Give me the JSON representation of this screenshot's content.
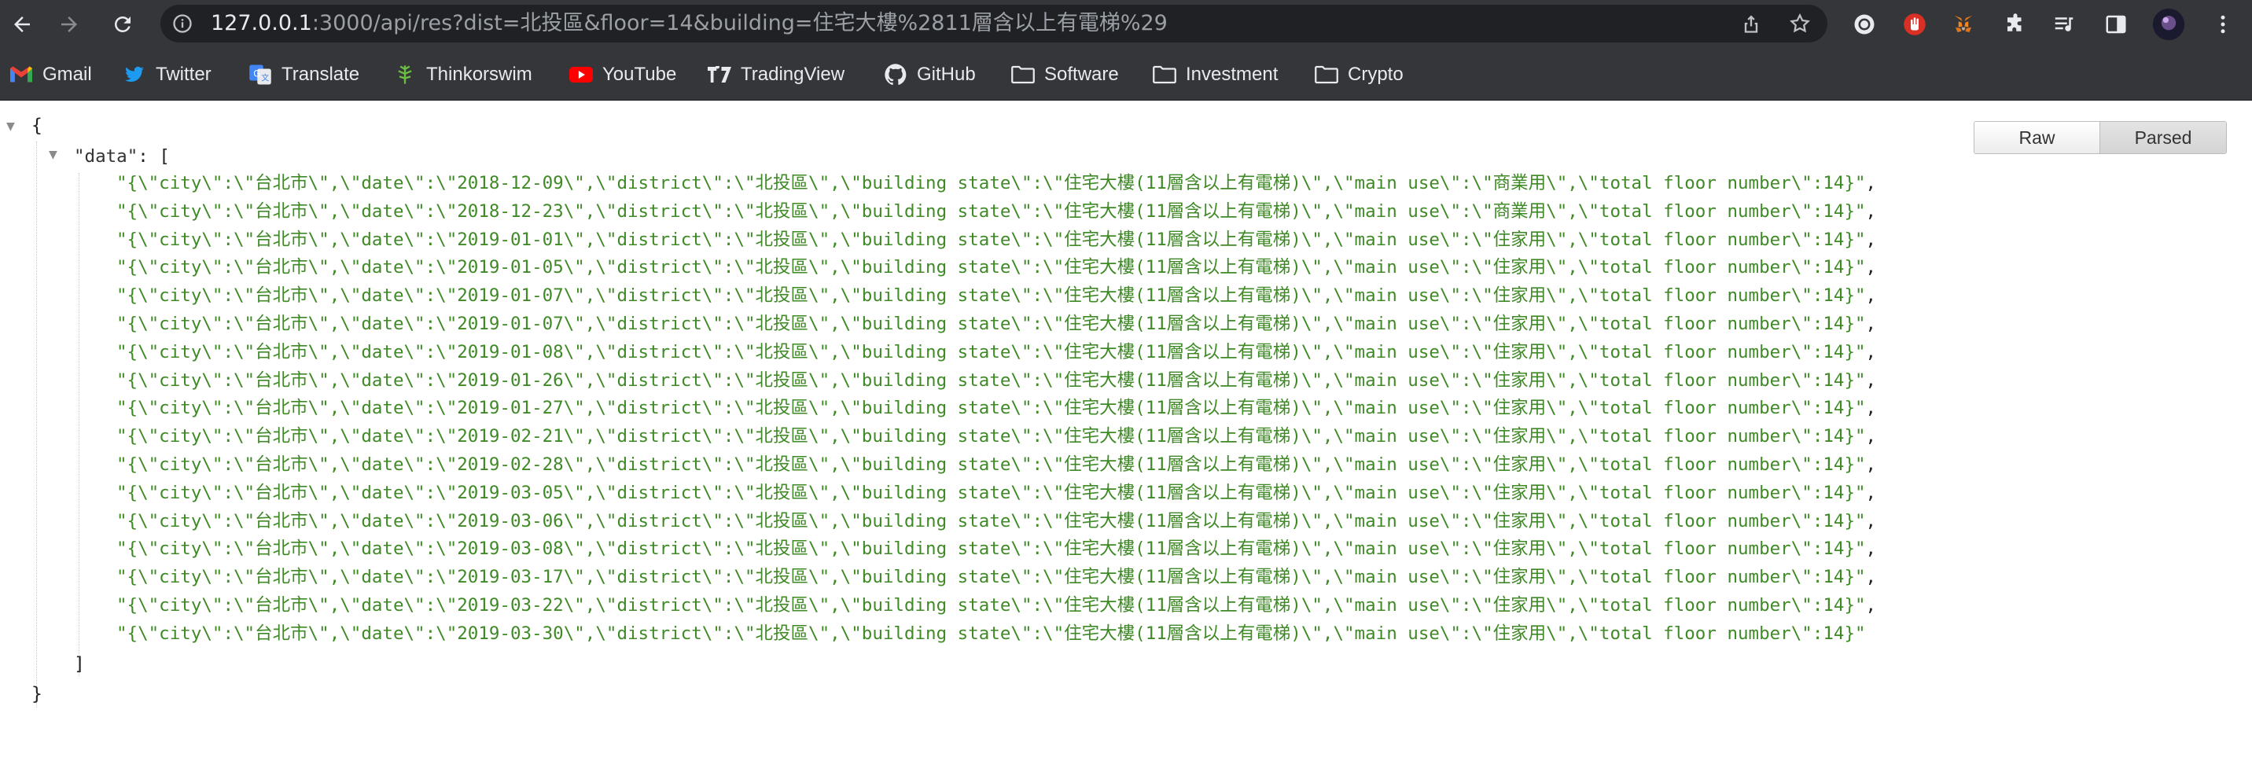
{
  "browser": {
    "url_host": "127.0.0.1",
    "url_rest": ":3000/api/res?dist=北投區&floor=14&building=住宅大樓%2811層含以上有電梯%29"
  },
  "bookmarks": [
    {
      "label": "Gmail",
      "icon": "gmail-icon"
    },
    {
      "label": "Twitter",
      "icon": "twitter-icon"
    },
    {
      "label": "Translate",
      "icon": "translate-icon"
    },
    {
      "label": "Thinkorswim",
      "icon": "thinkorswim-icon"
    },
    {
      "label": "YouTube",
      "icon": "youtube-icon"
    },
    {
      "label": "TradingView",
      "icon": "tradingview-icon"
    },
    {
      "label": "GitHub",
      "icon": "github-icon"
    },
    {
      "label": "Software",
      "icon": "folder-icon"
    },
    {
      "label": "Investment",
      "icon": "folder-icon"
    },
    {
      "label": "Crypto",
      "icon": "folder-icon"
    }
  ],
  "viewer": {
    "raw_label": "Raw",
    "parsed_label": "Parsed",
    "open_brace": "{",
    "close_brace": "}",
    "key_label": "\"data\"",
    "key_colon": ": [",
    "close_bracket": "]"
  },
  "rows": [
    "\"{\\\"city\\\":\\\"台北市\\\",\\\"date\\\":\\\"2018-12-09\\\",\\\"district\\\":\\\"北投區\\\",\\\"building state\\\":\\\"住宅大樓(11層含以上有電梯)\\\",\\\"main use\\\":\\\"商業用\\\",\\\"total floor number\\\":14}\"",
    "\"{\\\"city\\\":\\\"台北市\\\",\\\"date\\\":\\\"2018-12-23\\\",\\\"district\\\":\\\"北投區\\\",\\\"building state\\\":\\\"住宅大樓(11層含以上有電梯)\\\",\\\"main use\\\":\\\"商業用\\\",\\\"total floor number\\\":14}\"",
    "\"{\\\"city\\\":\\\"台北市\\\",\\\"date\\\":\\\"2019-01-01\\\",\\\"district\\\":\\\"北投區\\\",\\\"building state\\\":\\\"住宅大樓(11層含以上有電梯)\\\",\\\"main use\\\":\\\"住家用\\\",\\\"total floor number\\\":14}\"",
    "\"{\\\"city\\\":\\\"台北市\\\",\\\"date\\\":\\\"2019-01-05\\\",\\\"district\\\":\\\"北投區\\\",\\\"building state\\\":\\\"住宅大樓(11層含以上有電梯)\\\",\\\"main use\\\":\\\"住家用\\\",\\\"total floor number\\\":14}\"",
    "\"{\\\"city\\\":\\\"台北市\\\",\\\"date\\\":\\\"2019-01-07\\\",\\\"district\\\":\\\"北投區\\\",\\\"building state\\\":\\\"住宅大樓(11層含以上有電梯)\\\",\\\"main use\\\":\\\"住家用\\\",\\\"total floor number\\\":14}\"",
    "\"{\\\"city\\\":\\\"台北市\\\",\\\"date\\\":\\\"2019-01-07\\\",\\\"district\\\":\\\"北投區\\\",\\\"building state\\\":\\\"住宅大樓(11層含以上有電梯)\\\",\\\"main use\\\":\\\"住家用\\\",\\\"total floor number\\\":14}\"",
    "\"{\\\"city\\\":\\\"台北市\\\",\\\"date\\\":\\\"2019-01-08\\\",\\\"district\\\":\\\"北投區\\\",\\\"building state\\\":\\\"住宅大樓(11層含以上有電梯)\\\",\\\"main use\\\":\\\"住家用\\\",\\\"total floor number\\\":14}\"",
    "\"{\\\"city\\\":\\\"台北市\\\",\\\"date\\\":\\\"2019-01-26\\\",\\\"district\\\":\\\"北投區\\\",\\\"building state\\\":\\\"住宅大樓(11層含以上有電梯)\\\",\\\"main use\\\":\\\"住家用\\\",\\\"total floor number\\\":14}\"",
    "\"{\\\"city\\\":\\\"台北市\\\",\\\"date\\\":\\\"2019-01-27\\\",\\\"district\\\":\\\"北投區\\\",\\\"building state\\\":\\\"住宅大樓(11層含以上有電梯)\\\",\\\"main use\\\":\\\"住家用\\\",\\\"total floor number\\\":14}\"",
    "\"{\\\"city\\\":\\\"台北市\\\",\\\"date\\\":\\\"2019-02-21\\\",\\\"district\\\":\\\"北投區\\\",\\\"building state\\\":\\\"住宅大樓(11層含以上有電梯)\\\",\\\"main use\\\":\\\"住家用\\\",\\\"total floor number\\\":14}\"",
    "\"{\\\"city\\\":\\\"台北市\\\",\\\"date\\\":\\\"2019-02-28\\\",\\\"district\\\":\\\"北投區\\\",\\\"building state\\\":\\\"住宅大樓(11層含以上有電梯)\\\",\\\"main use\\\":\\\"住家用\\\",\\\"total floor number\\\":14}\"",
    "\"{\\\"city\\\":\\\"台北市\\\",\\\"date\\\":\\\"2019-03-05\\\",\\\"district\\\":\\\"北投區\\\",\\\"building state\\\":\\\"住宅大樓(11層含以上有電梯)\\\",\\\"main use\\\":\\\"住家用\\\",\\\"total floor number\\\":14}\"",
    "\"{\\\"city\\\":\\\"台北市\\\",\\\"date\\\":\\\"2019-03-06\\\",\\\"district\\\":\\\"北投區\\\",\\\"building state\\\":\\\"住宅大樓(11層含以上有電梯)\\\",\\\"main use\\\":\\\"住家用\\\",\\\"total floor number\\\":14}\"",
    "\"{\\\"city\\\":\\\"台北市\\\",\\\"date\\\":\\\"2019-03-08\\\",\\\"district\\\":\\\"北投區\\\",\\\"building state\\\":\\\"住宅大樓(11層含以上有電梯)\\\",\\\"main use\\\":\\\"住家用\\\",\\\"total floor number\\\":14}\"",
    "\"{\\\"city\\\":\\\"台北市\\\",\\\"date\\\":\\\"2019-03-17\\\",\\\"district\\\":\\\"北投區\\\",\\\"building state\\\":\\\"住宅大樓(11層含以上有電梯)\\\",\\\"main use\\\":\\\"住家用\\\",\\\"total floor number\\\":14}\"",
    "\"{\\\"city\\\":\\\"台北市\\\",\\\"date\\\":\\\"2019-03-22\\\",\\\"district\\\":\\\"北投區\\\",\\\"building state\\\":\\\"住宅大樓(11層含以上有電梯)\\\",\\\"main use\\\":\\\"住家用\\\",\\\"total floor number\\\":14}\"",
    "\"{\\\"city\\\":\\\"台北市\\\",\\\"date\\\":\\\"2019-03-30\\\",\\\"district\\\":\\\"北投區\\\",\\\"building state\\\":\\\"住宅大樓(11層含以上有電梯)\\\",\\\"main use\\\":\\\"住家用\\\",\\\"total floor number\\\":14}\""
  ]
}
